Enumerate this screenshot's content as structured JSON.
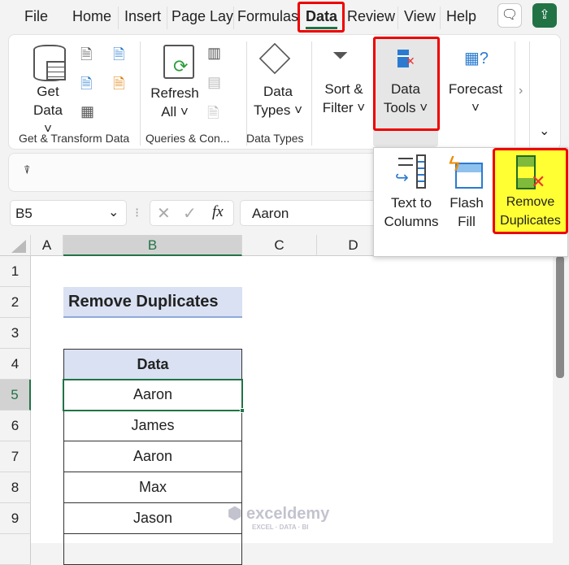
{
  "tabs": [
    "File",
    "Home",
    "Insert",
    "Page Lay",
    "Formulas",
    "Data",
    "Review",
    "View",
    "Help"
  ],
  "active_tab": "Data",
  "ribbon": {
    "get_data": "Get",
    "get_data2": "Data",
    "refresh": "Refresh",
    "refresh2": "All",
    "data_types": "Data",
    "data_types2": "Types",
    "sort": "Sort &",
    "sort2": "Filter",
    "data_tools": "Data",
    "data_tools2": "Tools",
    "forecast": "Forecast",
    "groups": [
      "Get & Transform Data",
      "Queries & Con...",
      "Data Types"
    ]
  },
  "popup": {
    "text_to": "Text to",
    "columns": "Columns",
    "flash": "Flash",
    "fill": "Fill",
    "remove": "Remove",
    "duplicates": "Duplicates"
  },
  "formula_bar": {
    "name_box": "B5",
    "fx": "fx",
    "value": "Aaron"
  },
  "columns": [
    "A",
    "B",
    "C",
    "D"
  ],
  "rows": [
    "1",
    "2",
    "3",
    "4",
    "5",
    "6",
    "7",
    "8",
    "9"
  ],
  "title_cell": "Remove Duplicates",
  "table": {
    "header": "Data",
    "values": [
      "Aaron",
      "James",
      "Aaron",
      "Max",
      "Jason"
    ]
  },
  "watermark": "exceldemy",
  "watermark_sub": "EXCEL · DATA · BI",
  "colors": {
    "accent": "#217346",
    "highlight": "#ffff33",
    "red": "#e00000"
  }
}
